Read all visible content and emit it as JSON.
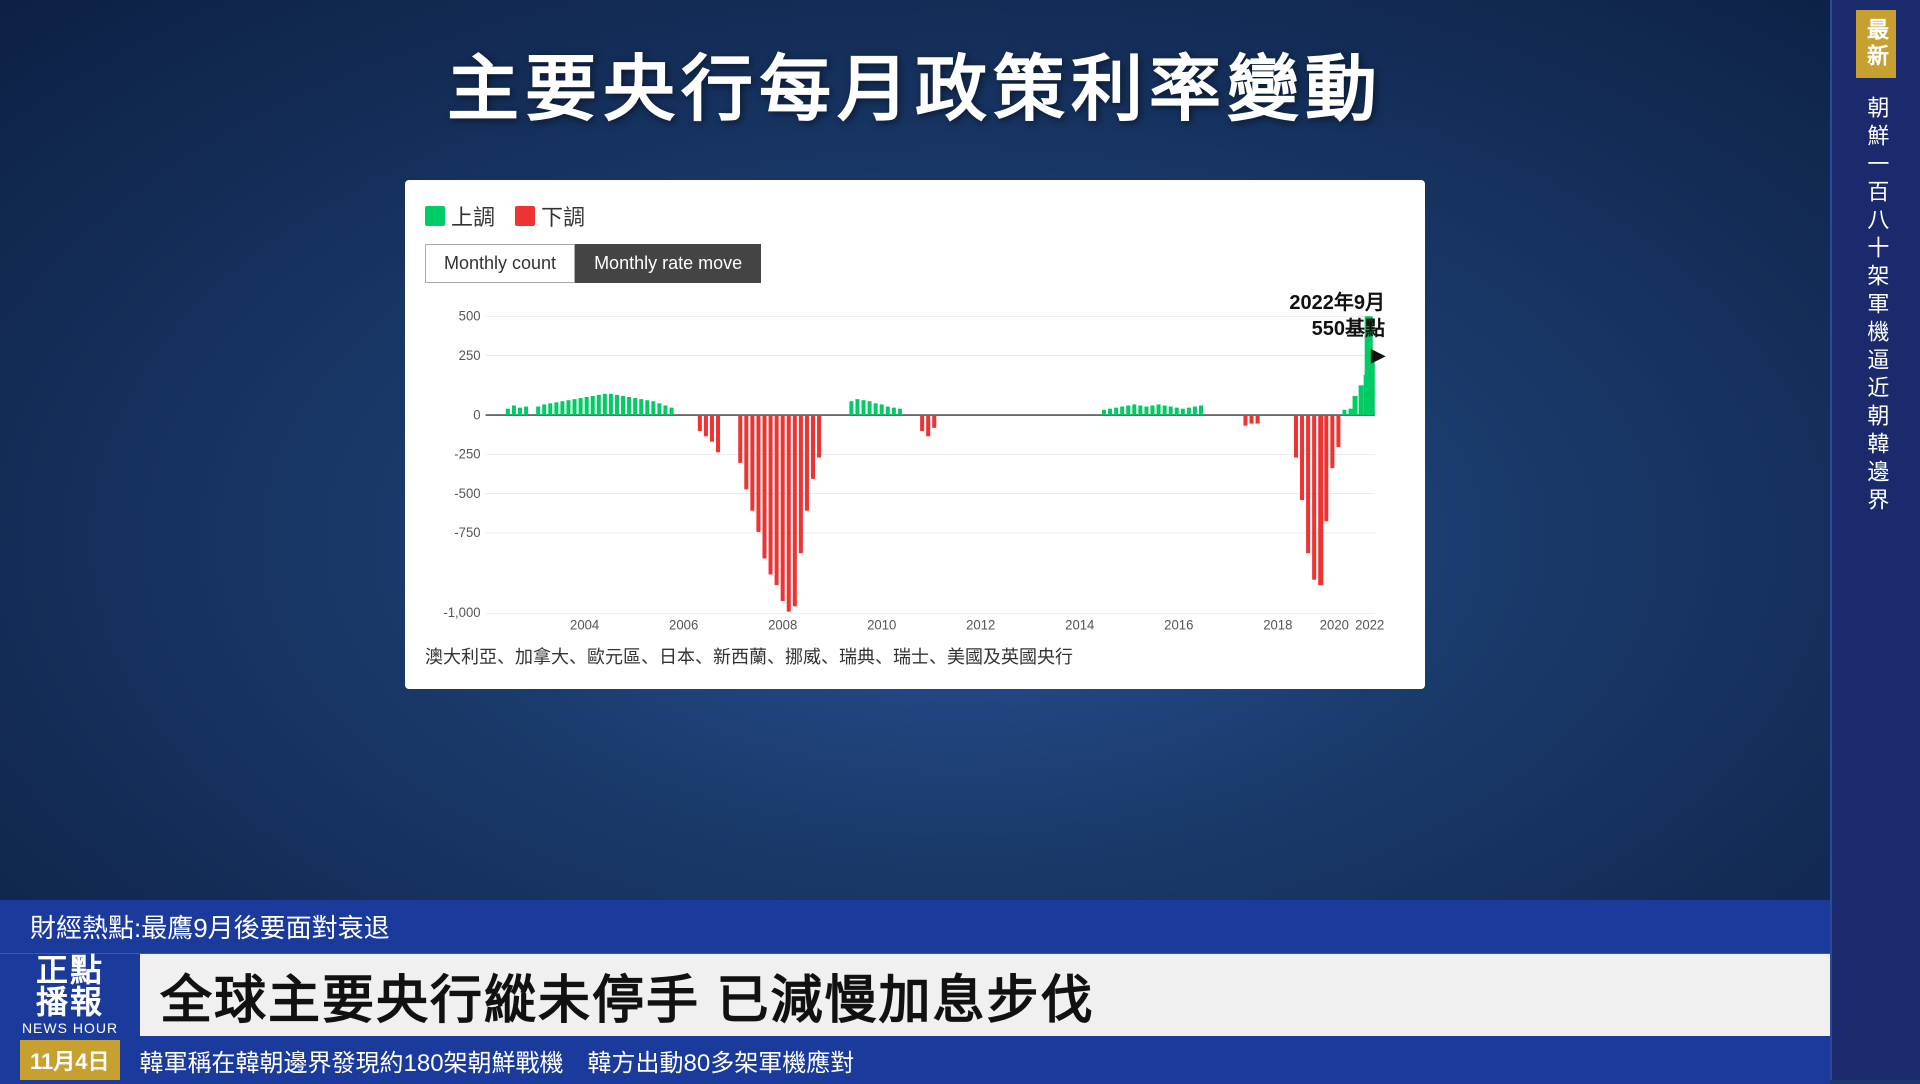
{
  "background": {
    "color_start": "#2a5298",
    "color_end": "#0d2044"
  },
  "main_title": "主要央行每月政策利率變動",
  "sidebar": {
    "tag": "最新",
    "text": "朝鮮一百八十架軍機逼近朝韓邊界"
  },
  "legend": {
    "up_label": "上調",
    "down_label": "下調",
    "up_color": "#00cc66",
    "down_color": "#ee3333"
  },
  "tabs": {
    "monthly_count": "Monthly count",
    "monthly_rate": "Monthly rate move"
  },
  "chart": {
    "annotation_year": "2022年9月",
    "annotation_value": "550基點",
    "y_axis_labels": [
      "500 基點",
      "250",
      "-250",
      "-500",
      "-750",
      "-1,000"
    ],
    "x_axis_labels": [
      "2004",
      "2006",
      "2008",
      "2010",
      "2012",
      "2014",
      "2016",
      "2018",
      "2020",
      "2022"
    ],
    "footer": "澳大利亞、加拿大、歐元區、日本、新西蘭、挪威、瑞典、瑞士、美國及英國央行"
  },
  "bottom_bar": {
    "ticker_top": "財經熱點:最鷹9月後要面對衰退",
    "logo_top": "正點",
    "logo_mid": "播報",
    "logo_bottom": "NEWS HOUR",
    "headline": "全球主要央行縱未停手 已減慢加息步伐",
    "date": "11月4日",
    "ticker_bottom": "韓軍稱在韓朝邊界發現約180架朝鮮戰機　韓方出動80多架軍機應對"
  }
}
